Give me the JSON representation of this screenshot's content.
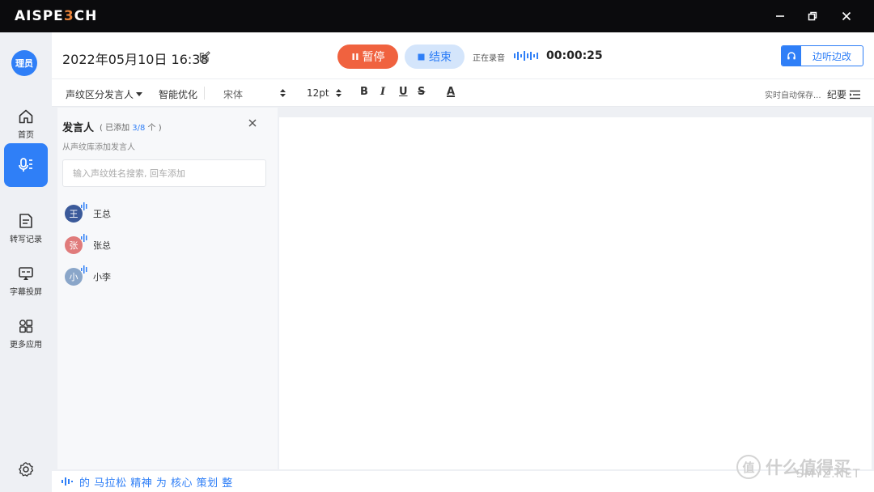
{
  "titlebar": {
    "brand_a": "AISPE",
    "brand_b": "3",
    "brand_c": "CH"
  },
  "nav": {
    "avatar_text": "理员",
    "items": [
      {
        "label": "首页",
        "icon": "home-icon"
      },
      {
        "label": "",
        "icon": "microphone-icon"
      },
      {
        "label": "转写记录",
        "icon": "document-icon"
      },
      {
        "label": "字幕投屏",
        "icon": "screen-cast-icon"
      },
      {
        "label": "更多应用",
        "icon": "apps-grid-icon"
      }
    ]
  },
  "header": {
    "datetime": "2022年05月10日 16:38",
    "pause_label": "暂停",
    "end_label": "结束",
    "recording_status": "正在录音",
    "timer": "00:00:25",
    "listen_edit_label": "边听边改"
  },
  "toolbar": {
    "speaker_mode": "声纹区分发言人",
    "smart_optimize": "智能优化",
    "font": "宋体",
    "font_size": "12pt",
    "bold": "B",
    "italic": "I",
    "underline": "U",
    "strike": "S",
    "font_color": "A",
    "autosave": "实时自动保存...",
    "summary": "纪要"
  },
  "speakers": {
    "title": "发言人",
    "count_prefix": "( 已添加 ",
    "count_value": "3/8",
    "count_suffix": " 个 )",
    "subtitle": "从声纹库添加发言人",
    "search_placeholder": "输入声纹姓名搜索, 回车添加",
    "list": [
      {
        "avatar": "王",
        "name": "王总",
        "color": "#3b5a9a"
      },
      {
        "avatar": "张",
        "name": "张总",
        "color": "#e07b7b"
      },
      {
        "avatar": "小",
        "name": "小李",
        "color": "#8aa6c9"
      }
    ]
  },
  "live_transcript": "的 马拉松 精神 为 核心 策划 整",
  "watermark": {
    "icon_char": "值",
    "text": "什么值得买",
    "site": "SMYZ.NET"
  },
  "colors": {
    "accent": "#2f7ff7",
    "pause": "#f0623f",
    "end_bg": "#d4e5fb"
  }
}
